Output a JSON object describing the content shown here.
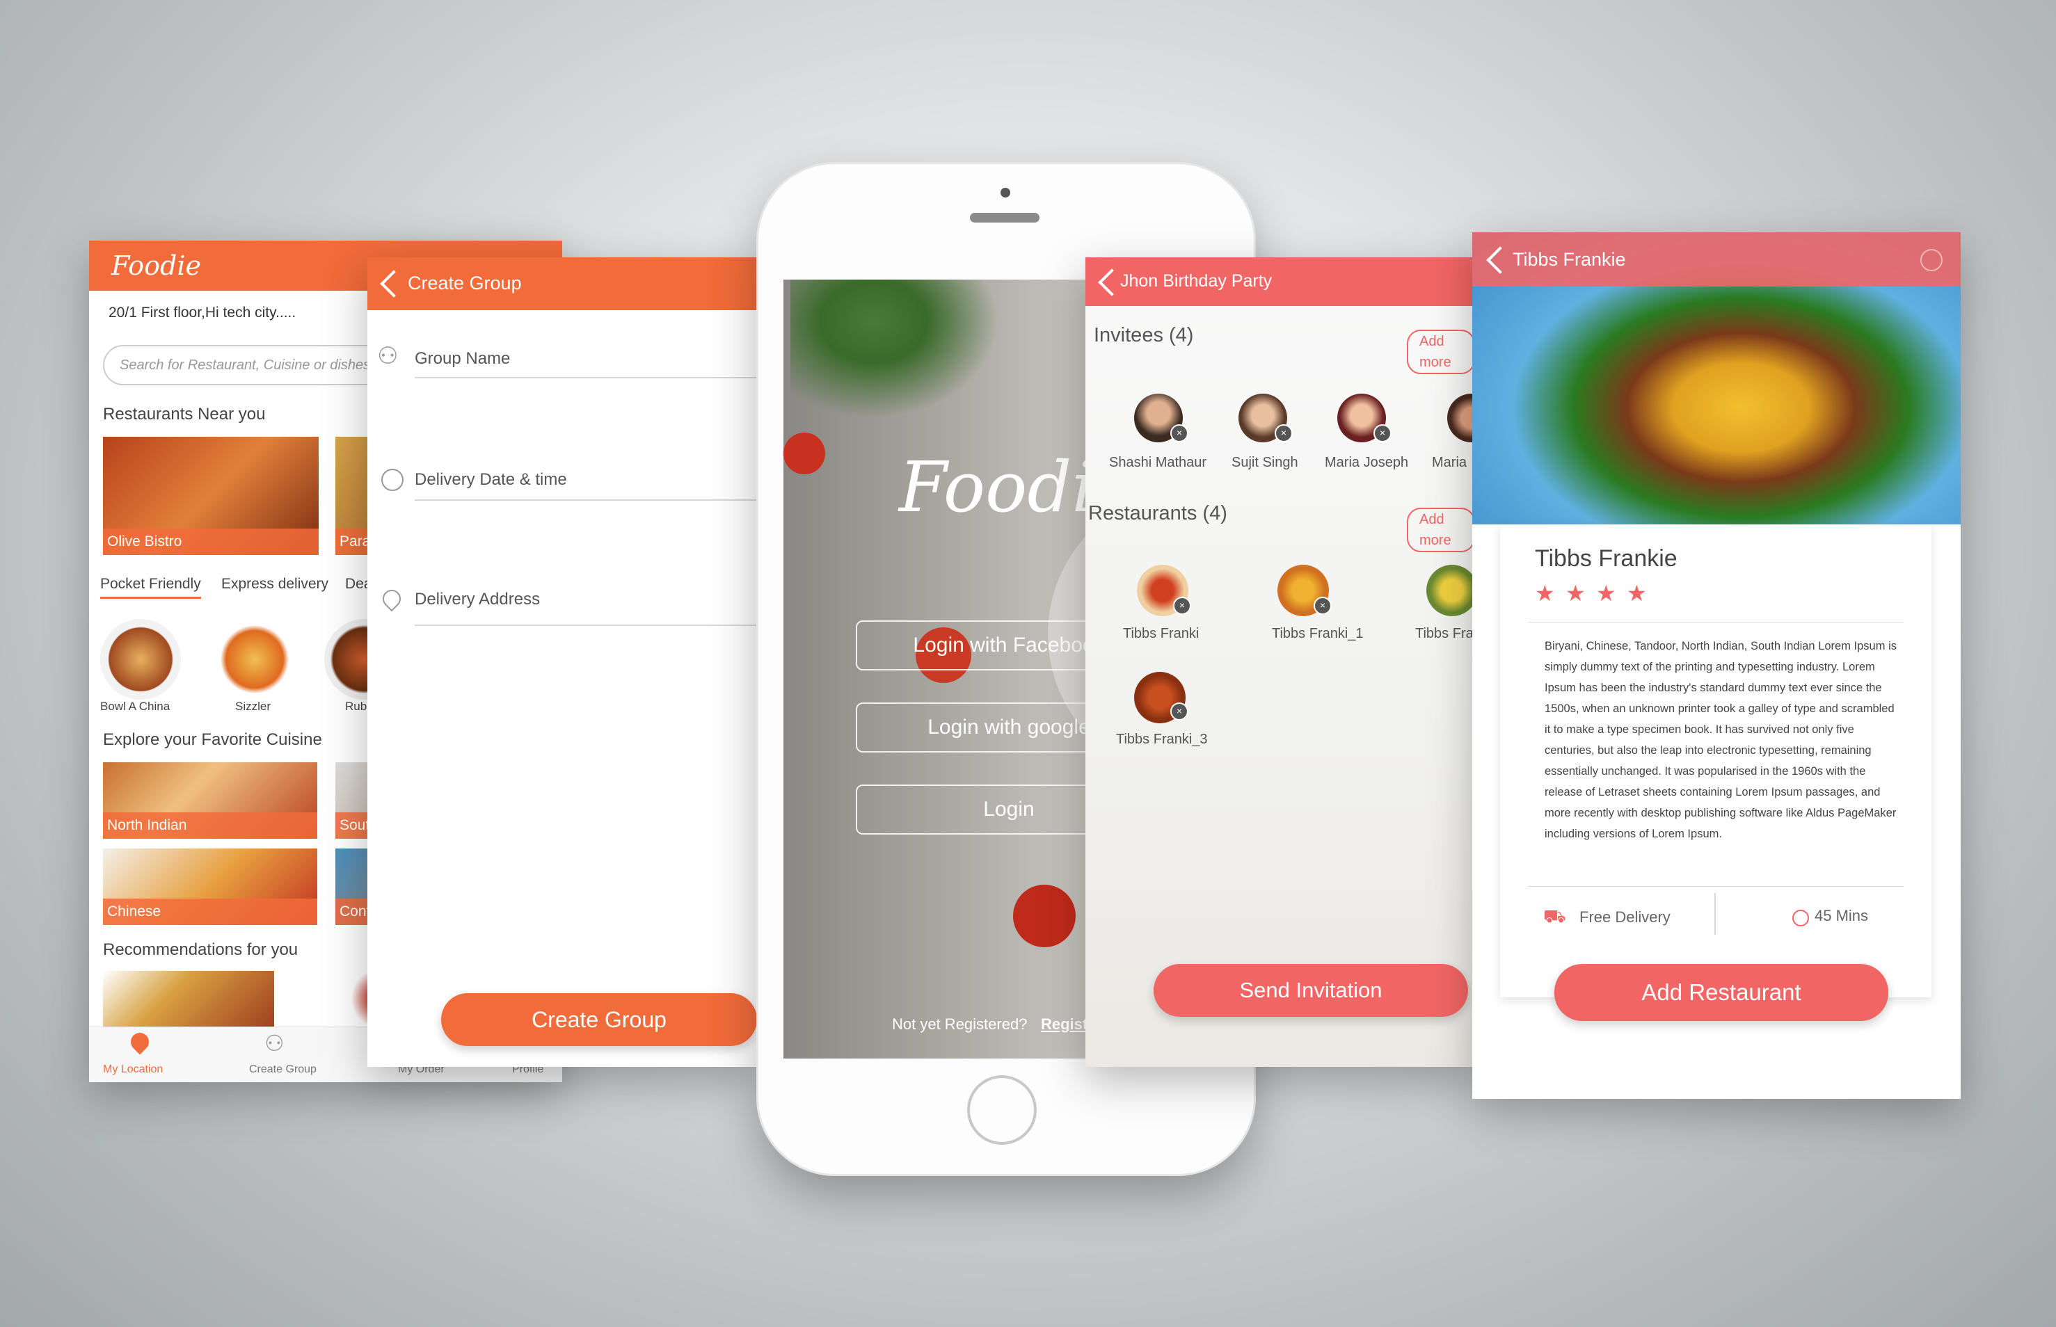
{
  "home": {
    "brand": "Foodie",
    "address": "20/1 First floor,Hi tech city.....",
    "search_placeholder": "Search for Restaurant, Cuisine or dishes",
    "near_title": "Restaurants Near you",
    "near": [
      "Olive Bistro",
      "Para"
    ],
    "filters": [
      "Pocket Friendly",
      "Express delivery",
      "Deals"
    ],
    "circles": [
      "Bowl A China",
      "Sizzler",
      "Rub"
    ],
    "cuisine_title": "Explore your Favorite Cuisine",
    "cuisines": [
      "North Indian",
      "South",
      "Chinese",
      "Cont"
    ],
    "rec_title": "Recommendations for you",
    "nav": [
      "My Location",
      "Create Group",
      "My Order",
      "Profile"
    ]
  },
  "create_group": {
    "title": "Create Group",
    "group_name": "Group Name",
    "delivery_date": "Delivery Date & time",
    "delivery_address": "Delivery Address",
    "button": "Create Group"
  },
  "login": {
    "brand": "Foodie",
    "facebook": "Login with Facebook",
    "google": "Login with google",
    "login": "Login",
    "register_prompt": "Not yet Registered?",
    "register_link": "Register"
  },
  "party": {
    "title": "Jhon Birthday Party",
    "invitees_title": "Invitees (4)",
    "add_more": "Add more",
    "invitees": [
      "Shashi Mathaur",
      "Sujit Singh",
      "Maria Joseph",
      "Maria"
    ],
    "restaurants_title": "Restaurants (4)",
    "restaurants": [
      "Tibbs Franki",
      "Tibbs Franki_1",
      "Tibbs Franki",
      "Tibbs Franki_3"
    ],
    "button": "Send Invitation"
  },
  "detail": {
    "header": "Tibbs Frankie",
    "name": "Tibbs Frankie",
    "rating": 4,
    "description": "Biryani, Chinese, Tandoor, North Indian, South Indian Lorem Ipsum is simply dummy text of the printing and typesetting industry. Lorem Ipsum has been the industry's standard dummy text ever since the 1500s, when an unknown printer took a galley of type and scrambled it to make a type specimen book. It has survived not only five centuries, but also the leap into electronic typesetting, remaining essentially unchanged. It was popularised in the 1960s with the release of Letraset sheets containing Lorem Ipsum passages, and more recently with desktop publishing software like Aldus PageMaker including versions of Lorem Ipsum.",
    "delivery": "Free Delivery",
    "time": "45 Mins",
    "button": "Add Restaurant"
  },
  "colors": {
    "orange": "#f26b3a",
    "coral": "#f26565"
  }
}
